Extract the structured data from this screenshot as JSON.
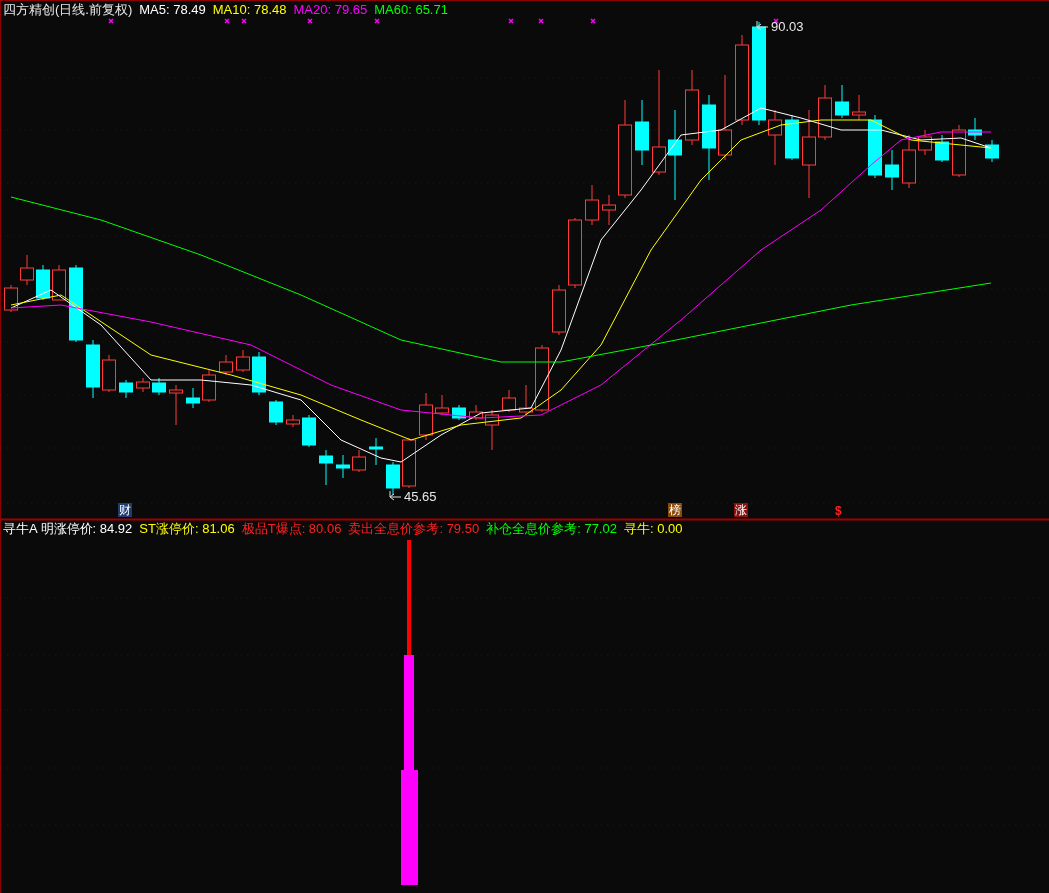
{
  "header": {
    "title": "四方精创(日线.前复权)",
    "indicators": [
      {
        "label": "MA5: 78.49",
        "color": "#ffffff"
      },
      {
        "label": "MA10: 78.48",
        "color": "#ffff00"
      },
      {
        "label": "MA20: 79.65",
        "color": "#ff00ff"
      },
      {
        "label": "MA60: 65.71",
        "color": "#00ff00"
      }
    ]
  },
  "price_labels": [
    {
      "text": "90.03"
    },
    {
      "text": "45.65"
    }
  ],
  "event_tags": [
    {
      "text": "财",
      "kind": "box",
      "color": "#1f3c72"
    },
    {
      "text": "榜",
      "kind": "box",
      "color": "#8a4a0c"
    },
    {
      "text": "涨",
      "kind": "box",
      "color": "#8a1010"
    },
    {
      "text": "$",
      "kind": "plain",
      "color": "#ff2020"
    }
  ],
  "indicator_panel": {
    "items": [
      {
        "label": "寻牛A 明涨停价: 84.92",
        "color": "#ffffff"
      },
      {
        "label": "ST涨停价: 81.06",
        "color": "#ffff00"
      },
      {
        "label": "极品T爆点: 80.06",
        "color": "#ff2020"
      },
      {
        "label": "卖出全息价参考: 79.50",
        "color": "#ff2020"
      },
      {
        "label": "补仓全息价参考: 77.02",
        "color": "#00ff00"
      },
      {
        "label": "寻牛: 0.00",
        "color": "#ffff00"
      }
    ]
  }
}
